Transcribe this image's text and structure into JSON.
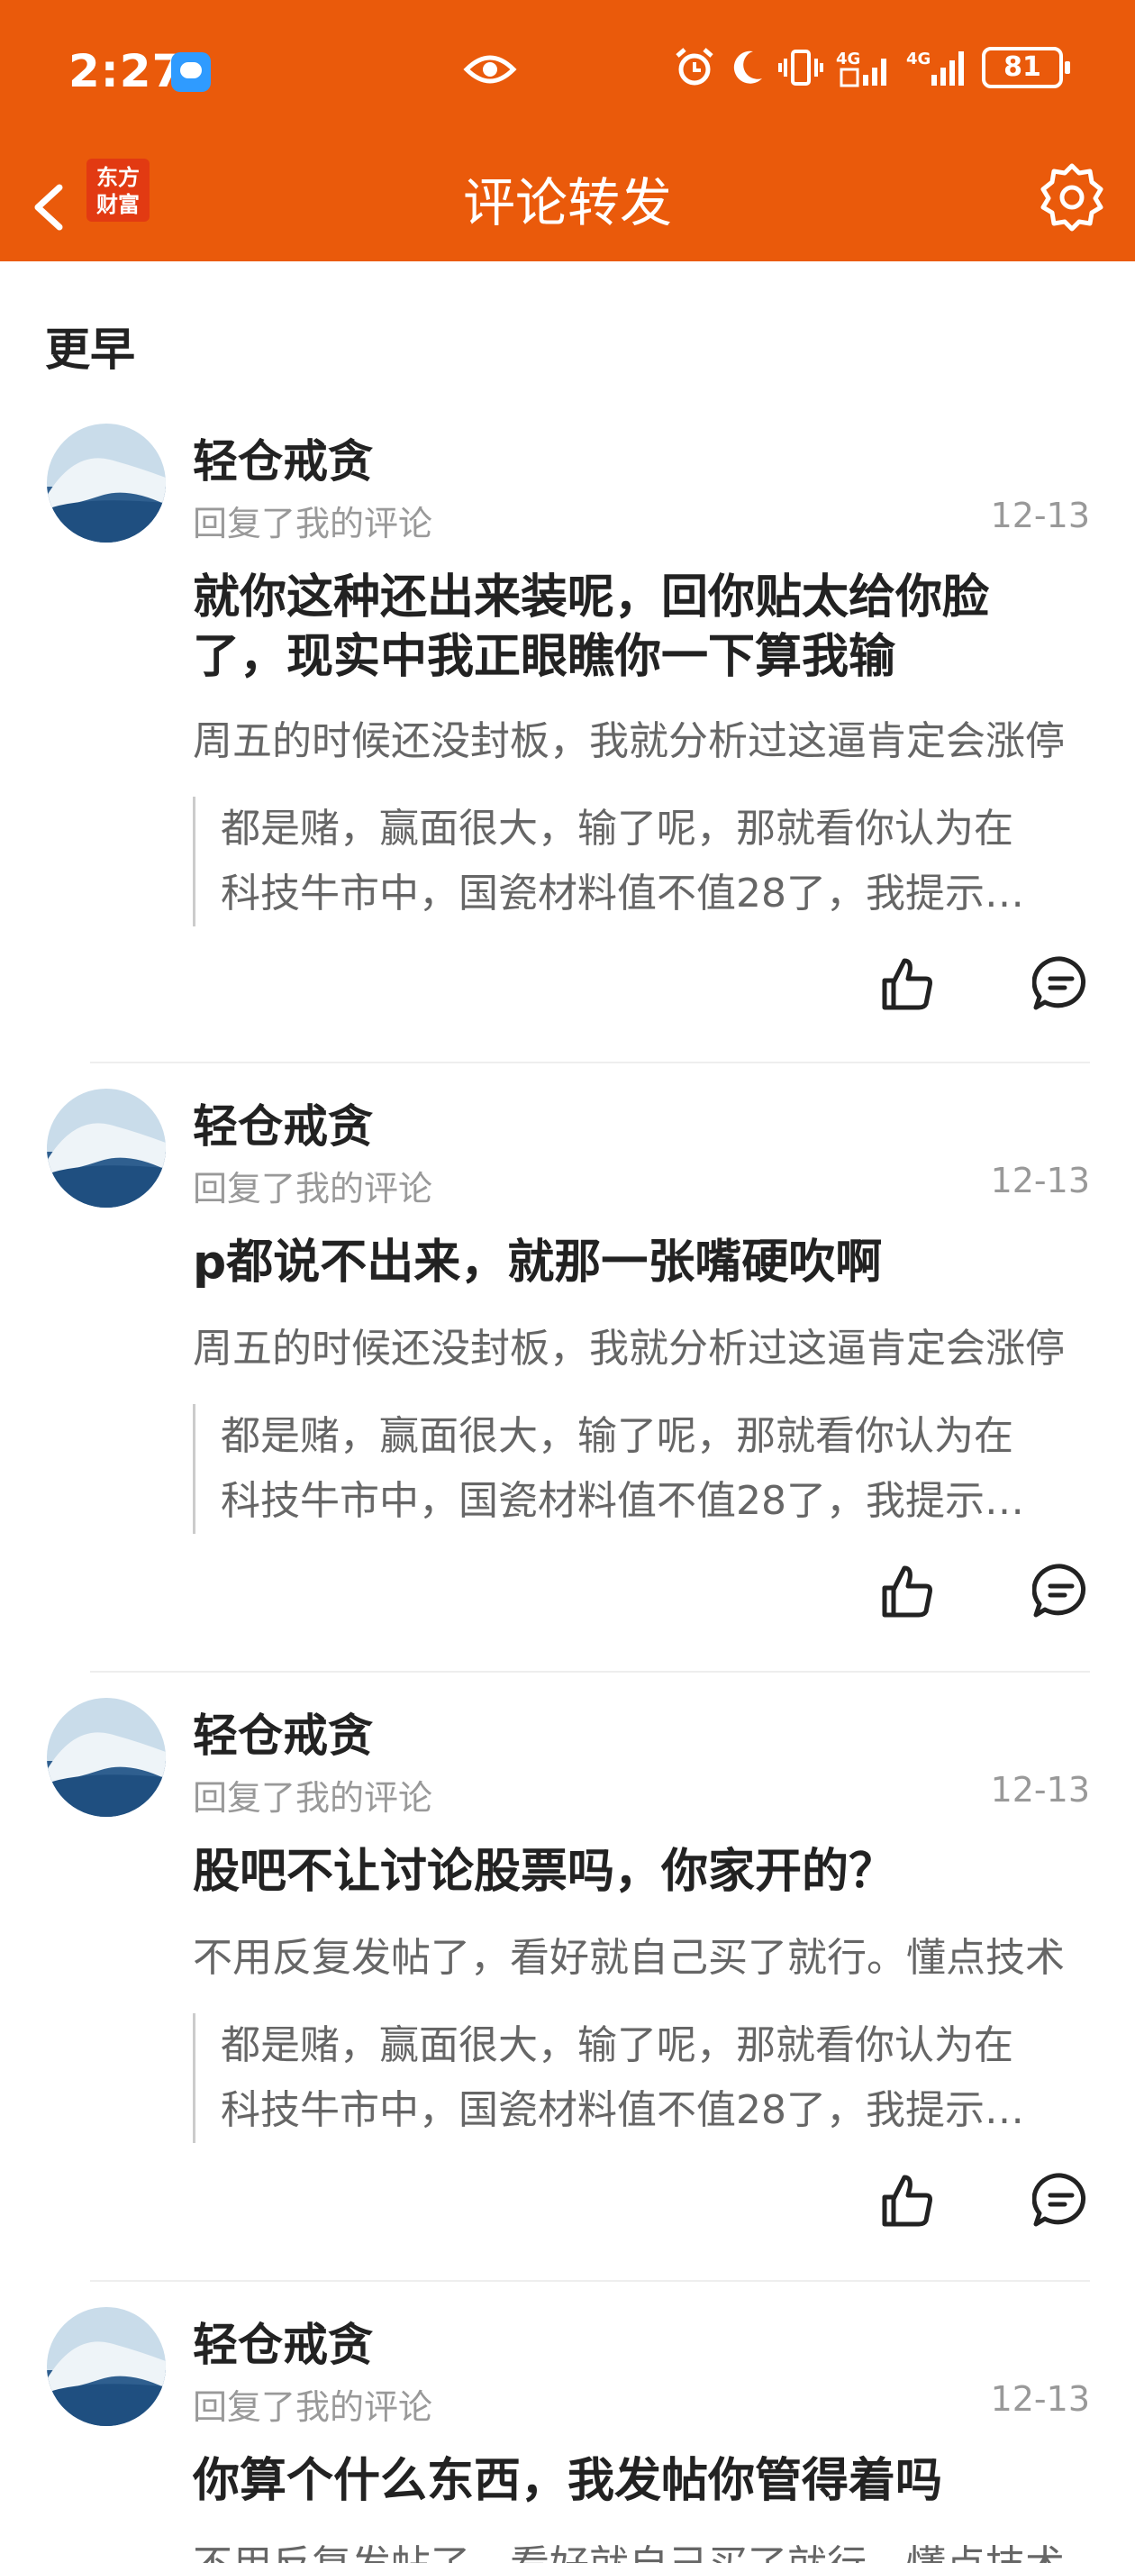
{
  "status_bar": {
    "time": "2:27",
    "battery": "81"
  },
  "header": {
    "logo_line1": "东方",
    "logo_line2": "财富",
    "title": "评论转发"
  },
  "section": {
    "title": "更早"
  },
  "cards": [
    {
      "user": "轻仓戒贪",
      "subtitle": "回复了我的评论",
      "date": "12-13",
      "comment_lines": [
        "就你这种还出来装呢，回你贴太给你脸",
        "了，现实中我正眼瞧你一下算我输"
      ],
      "quote": "周五的时候还没封板，我就分析过这逼肯定会涨停",
      "nested_lines": [
        "都是赌，赢面很大，输了呢，那就看你认为在",
        "科技牛市中，国瓷材料值不值28了，我提示…"
      ]
    },
    {
      "user": "轻仓戒贪",
      "subtitle": "回复了我的评论",
      "date": "12-13",
      "comment_lines": [
        "p都说不出来，就那一张嘴硬吹啊"
      ],
      "quote": "周五的时候还没封板，我就分析过这逼肯定会涨停",
      "nested_lines": [
        "都是赌，赢面很大，输了呢，那就看你认为在",
        "科技牛市中，国瓷材料值不值28了，我提示…"
      ]
    },
    {
      "user": "轻仓戒贪",
      "subtitle": "回复了我的评论",
      "date": "12-13",
      "comment_lines": [
        "股吧不让讨论股票吗，你家开的？"
      ],
      "quote": "不用反复发帖了，看好就自己买了就行。懂点技术",
      "nested_lines": [
        "都是赌，赢面很大，输了呢，那就看你认为在",
        "科技牛市中，国瓷材料值不值28了，我提示…"
      ]
    },
    {
      "user": "轻仓戒贪",
      "subtitle": "回复了我的评论",
      "date": "12-13",
      "comment_lines": [
        "你算个什么东西，我发帖你管得着吗"
      ],
      "quote": "不用反复发帖了，看好就自己买了就行。懂点技术"
    }
  ]
}
